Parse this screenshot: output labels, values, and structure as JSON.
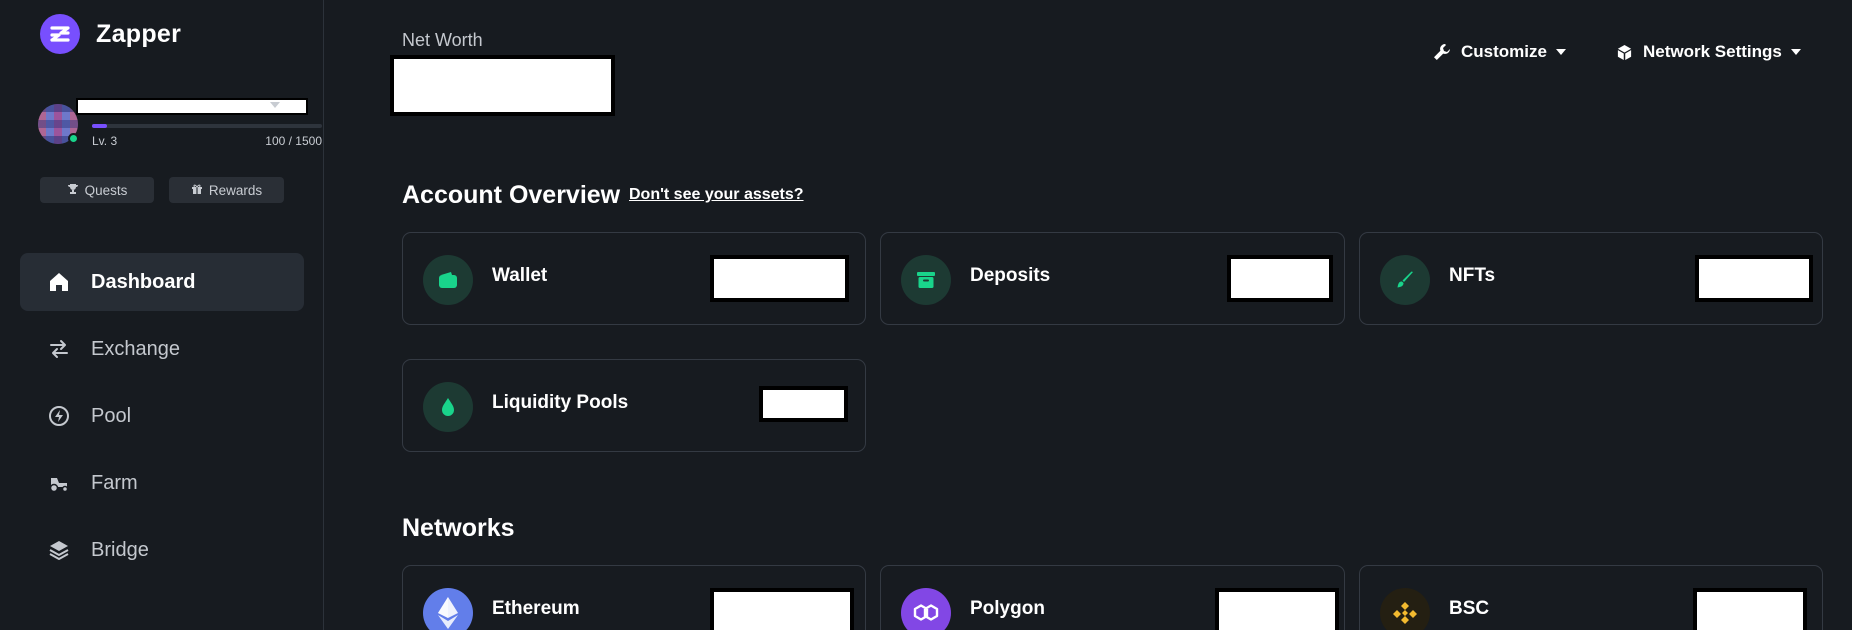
{
  "app": {
    "name": "Zapper"
  },
  "profile": {
    "level": "Lv. 3",
    "xp": "100 / 1500",
    "xp_fraction": 0.067
  },
  "chips": {
    "quests": "Quests",
    "rewards": "Rewards"
  },
  "nav": [
    {
      "label": "Dashboard",
      "icon": "home-icon",
      "active": true
    },
    {
      "label": "Exchange",
      "icon": "swap-arrows-icon",
      "active": false
    },
    {
      "label": "Pool",
      "icon": "bolt-circle-icon",
      "active": false
    },
    {
      "label": "Farm",
      "icon": "tractor-icon",
      "active": false
    },
    {
      "label": "Bridge",
      "icon": "layers-icon",
      "active": false
    }
  ],
  "header": {
    "net_worth_label": "Net Worth",
    "customize": "Customize",
    "network_settings": "Network Settings"
  },
  "account": {
    "title": "Account Overview",
    "missing_link": "Don't see your assets?",
    "cards": [
      {
        "label": "Wallet",
        "icon": "wallet-icon"
      },
      {
        "label": "Deposits",
        "icon": "archive-icon"
      },
      {
        "label": "NFTs",
        "icon": "brush-icon"
      },
      {
        "label": "Liquidity Pools",
        "icon": "droplet-icon"
      }
    ]
  },
  "networks": {
    "title": "Networks",
    "cards": [
      {
        "label": "Ethereum",
        "icon": "ethereum-icon",
        "color": "#627eea"
      },
      {
        "label": "Polygon",
        "icon": "polygon-icon",
        "color": "#8247e5"
      },
      {
        "label": "BSC",
        "icon": "bnb-icon",
        "color": "#f3ba2f"
      }
    ]
  },
  "colors": {
    "accent": "#784ffe",
    "success": "#19d48b",
    "background": "#171b20"
  }
}
